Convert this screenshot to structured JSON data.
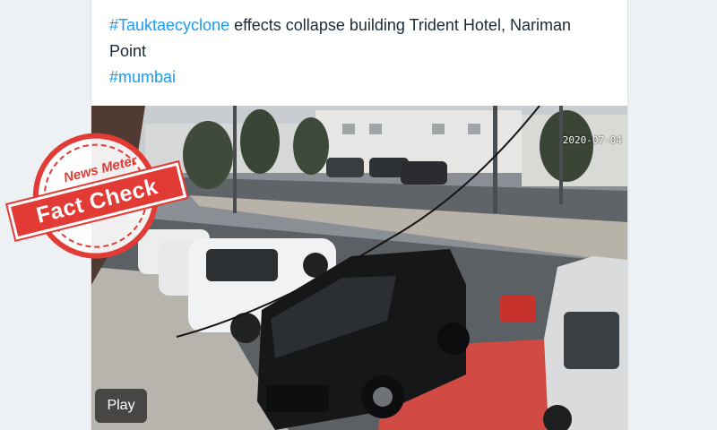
{
  "post": {
    "hashtag_primary": "#Tauktaecyclone",
    "text_line1": " effects collapse building Trident Hotel, Nariman",
    "text_line2": "Point",
    "hashtag_secondary": "#mumbai"
  },
  "media": {
    "timestamp": "2020-07-04",
    "play_label": "Play"
  },
  "stamp": {
    "brand": "News Meter",
    "label": "Fact Check",
    "color": "#e23b35"
  },
  "colors": {
    "hashtag": "#1d9bf0",
    "text": "#1c2a36"
  }
}
